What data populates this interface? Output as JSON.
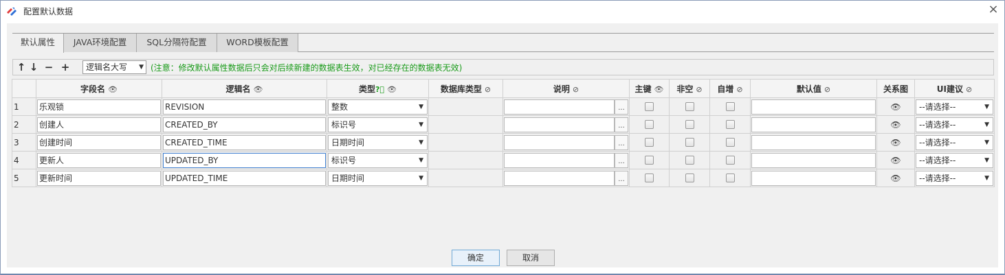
{
  "window": {
    "title": "配置默认数据",
    "close": "×"
  },
  "tabs": [
    {
      "label": "默认属性",
      "active": true
    },
    {
      "label": "JAVA环境配置",
      "active": false
    },
    {
      "label": "SQL分隔符配置",
      "active": false
    },
    {
      "label": "WORD模板配置",
      "active": false
    }
  ],
  "toolbar": {
    "move_up": "↑",
    "move_down": "↓",
    "remove": "−",
    "add": "+",
    "case_select": "逻辑名大写",
    "notice": "(注意：修改默认属性数据后只会对后续新建的数据表生效，对已经存在的数据表无效)"
  },
  "columns": {
    "index": "",
    "field_name": "字段名",
    "logic_name": "逻辑名",
    "type": "类型",
    "db_type": "数据库类型",
    "desc": "说明",
    "pk": "主键",
    "not_null": "非空",
    "auto_inc": "自增",
    "default": "默认值",
    "relation": "关系图",
    "ui_hint": "UI建议"
  },
  "rows": [
    {
      "index": "1",
      "field_name": "乐观锁",
      "logic_name": "REVISION",
      "type": "整数",
      "db_type": "",
      "desc": "",
      "default": "",
      "ui_hint": "--请选择--"
    },
    {
      "index": "2",
      "field_name": "创建人",
      "logic_name": "CREATED_BY",
      "type": "标识号",
      "db_type": "",
      "desc": "",
      "default": "",
      "ui_hint": "--请选择--"
    },
    {
      "index": "3",
      "field_name": "创建时间",
      "logic_name": "CREATED_TIME",
      "type": "日期时间",
      "db_type": "",
      "desc": "",
      "default": "",
      "ui_hint": "--请选择--"
    },
    {
      "index": "4",
      "field_name": "更新人",
      "logic_name": "UPDATED_BY",
      "type": "标识号",
      "db_type": "",
      "desc": "",
      "default": "",
      "ui_hint": "--请选择--"
    },
    {
      "index": "5",
      "field_name": "更新时间",
      "logic_name": "UPDATED_TIME",
      "type": "日期时间",
      "db_type": "",
      "desc": "",
      "default": "",
      "ui_hint": "--请选择--"
    }
  ],
  "footer": {
    "ok": "确定",
    "cancel": "取消"
  },
  "colors": {
    "notice": "#1a9b1a",
    "focus_border": "#3f7fd0",
    "ok_border": "#6ea8d6"
  }
}
